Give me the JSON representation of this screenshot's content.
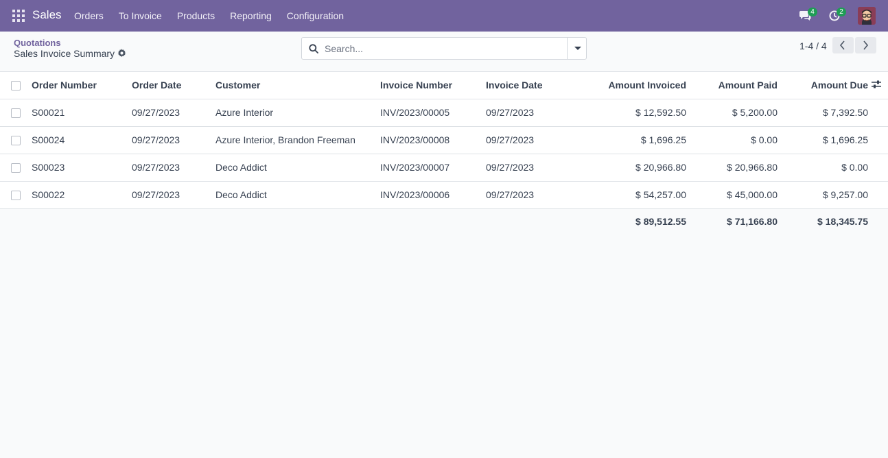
{
  "navbar": {
    "brand": "Sales",
    "menu": [
      "Orders",
      "To Invoice",
      "Products",
      "Reporting",
      "Configuration"
    ],
    "chat_count": "4",
    "activity_count": "2"
  },
  "control": {
    "breadcrumb": "Quotations",
    "title": "Sales Invoice Summary",
    "search_placeholder": "Search...",
    "pager": "1-4 / 4"
  },
  "table": {
    "columns": [
      "Order Number",
      "Order Date",
      "Customer",
      "Invoice Number",
      "Invoice Date",
      "Amount Invoiced",
      "Amount Paid",
      "Amount Due"
    ],
    "rows": [
      [
        "S00021",
        "09/27/2023",
        "Azure Interior",
        "INV/2023/00005",
        "09/27/2023",
        "$ 12,592.50",
        "$ 5,200.00",
        "$ 7,392.50"
      ],
      [
        "S00024",
        "09/27/2023",
        "Azure Interior, Brandon Freeman",
        "INV/2023/00008",
        "09/27/2023",
        "$ 1,696.25",
        "$ 0.00",
        "$ 1,696.25"
      ],
      [
        "S00023",
        "09/27/2023",
        "Deco Addict",
        "INV/2023/00007",
        "09/27/2023",
        "$ 20,966.80",
        "$ 20,966.80",
        "$ 0.00"
      ],
      [
        "S00022",
        "09/27/2023",
        "Deco Addict",
        "INV/2023/00006",
        "09/27/2023",
        "$ 54,257.00",
        "$ 45,000.00",
        "$ 9,257.00"
      ]
    ],
    "totals": {
      "amount_invoiced": "$ 89,512.55",
      "amount_paid": "$ 71,166.80",
      "amount_due": "$ 18,345.75"
    }
  },
  "colors": {
    "navbar": "#71639e",
    "accent": "#71639e",
    "badge": "#1f9d55"
  }
}
